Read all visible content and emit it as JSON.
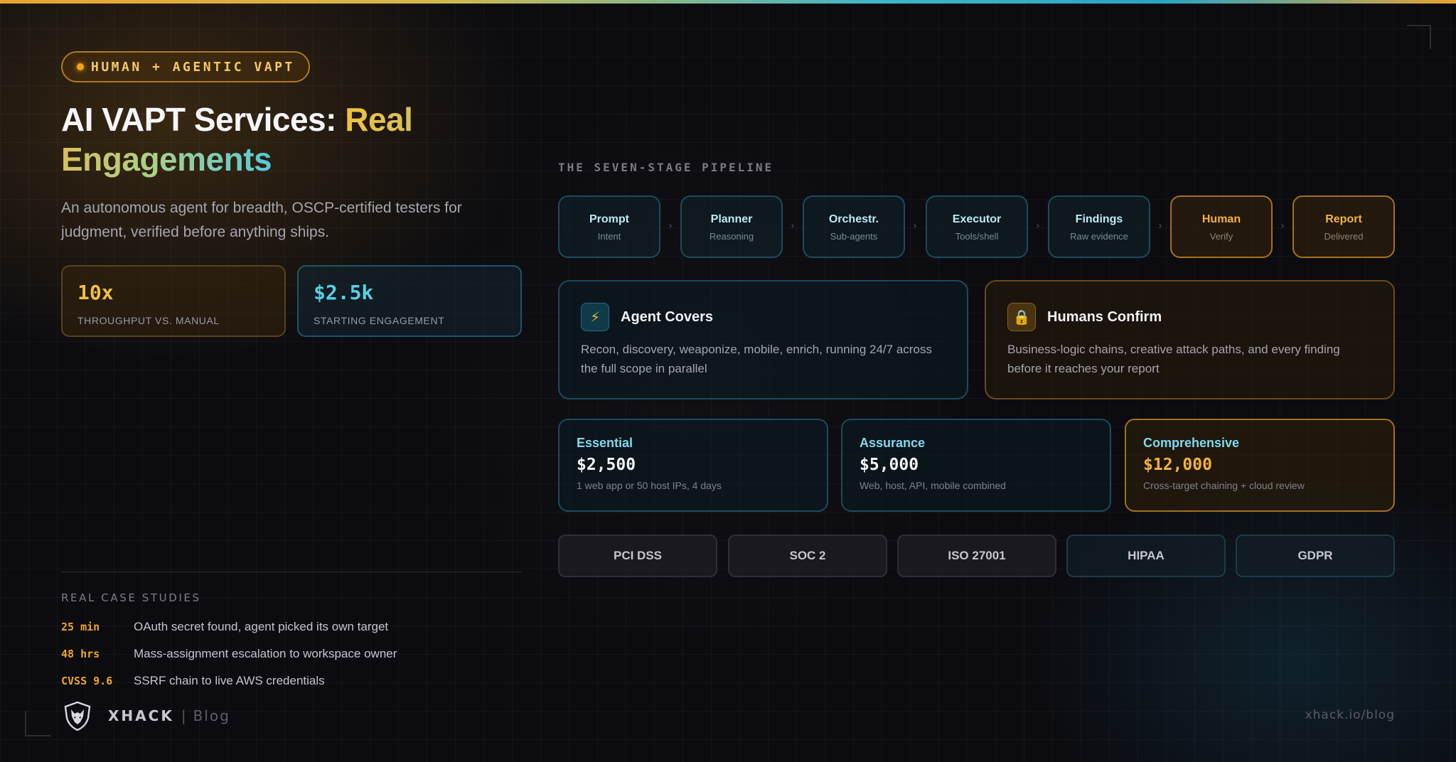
{
  "badge": "HUMAN + AGENTIC VAPT",
  "title": {
    "white": "AI VAPT Services: ",
    "accent1": "Real",
    "accent2": "Engagements"
  },
  "subtitle": "An autonomous agent for breadth, OSCP-certified testers for judgment, verified before anything ships.",
  "stats": [
    {
      "value": "10x",
      "label": "THROUGHPUT VS. MANUAL"
    },
    {
      "value": "$2.5k",
      "label": "STARTING ENGAGEMENT"
    }
  ],
  "cases": {
    "heading": "REAL CASE STUDIES",
    "items": [
      {
        "key": "25 min",
        "text": "OAuth secret found, agent picked its own target"
      },
      {
        "key": "48 hrs",
        "text": "Mass-assignment escalation to workspace owner"
      },
      {
        "key": "CVSS 9.6",
        "text": "SSRF chain to live AWS credentials"
      }
    ]
  },
  "brand": {
    "name": "XHACK",
    "separator": "|",
    "section": "Blog",
    "logo_icon": "wolf-shield-icon"
  },
  "url": "xhack.io/blog",
  "pipeline": {
    "heading": "THE SEVEN-STAGE PIPELINE",
    "arrow": "›",
    "stages": [
      {
        "name": "Prompt",
        "sub": "Intent"
      },
      {
        "name": "Planner",
        "sub": "Reasoning"
      },
      {
        "name": "Orchestr.",
        "sub": "Sub-agents"
      },
      {
        "name": "Executor",
        "sub": "Tools/shell"
      },
      {
        "name": "Findings",
        "sub": "Raw evidence"
      },
      {
        "name": "Human",
        "sub": "Verify"
      },
      {
        "name": "Report",
        "sub": "Delivered"
      }
    ]
  },
  "features": [
    {
      "icon": "lightning-icon",
      "glyph": "⚡",
      "title": "Agent Covers",
      "text": "Recon, discovery, weaponize, mobile, enrich, running 24/7 across the full scope in parallel"
    },
    {
      "icon": "lock-icon",
      "glyph": "🔒",
      "title": "Humans Confirm",
      "text": "Business-logic chains, creative attack paths, and every finding before it reaches your report"
    }
  ],
  "tiers": [
    {
      "name": "Essential",
      "price": "$2,500",
      "desc": "1 web app or 50 host IPs, 4 days"
    },
    {
      "name": "Assurance",
      "price": "$5,000",
      "desc": "Web, host, API, mobile combined"
    },
    {
      "name": "Comprehensive",
      "price": "$12,000",
      "desc": "Cross-target chaining + cloud review"
    }
  ],
  "compliance": [
    "PCI DSS",
    "SOC 2",
    "ISO 27001",
    "HIPAA",
    "GDPR"
  ],
  "colors": {
    "amber": "#f0a526",
    "cyan": "#56cfe6",
    "background": "#0c0c10"
  }
}
